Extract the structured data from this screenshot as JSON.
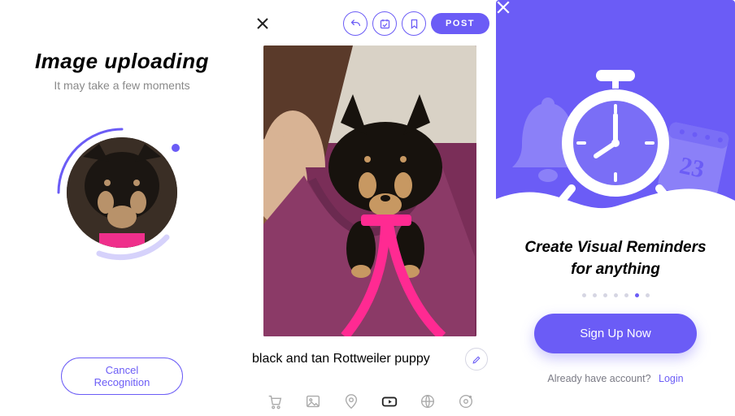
{
  "upload": {
    "title": "Image uploading",
    "subtitle": "It may take a few moments",
    "cancel_label": "Cancel Recognition"
  },
  "composer": {
    "post_label": "POST",
    "caption": "black and tan Rottweiler puppy",
    "actions": [
      "reply-icon",
      "calendar-check-icon",
      "bookmark-icon"
    ],
    "tools": [
      "cart-icon",
      "image-icon",
      "pin-icon",
      "video-icon",
      "globe-icon",
      "disc-icon"
    ],
    "active_tool_index": 3
  },
  "onboard": {
    "title": "Create Visual Reminders for anything",
    "signup_label": "Sign Up Now",
    "have_account": "Already have account?",
    "login_label": "Login",
    "calendar_day": "23",
    "page_count": 7,
    "active_page_index": 5
  },
  "colors": {
    "accent": "#6b5cf6"
  }
}
